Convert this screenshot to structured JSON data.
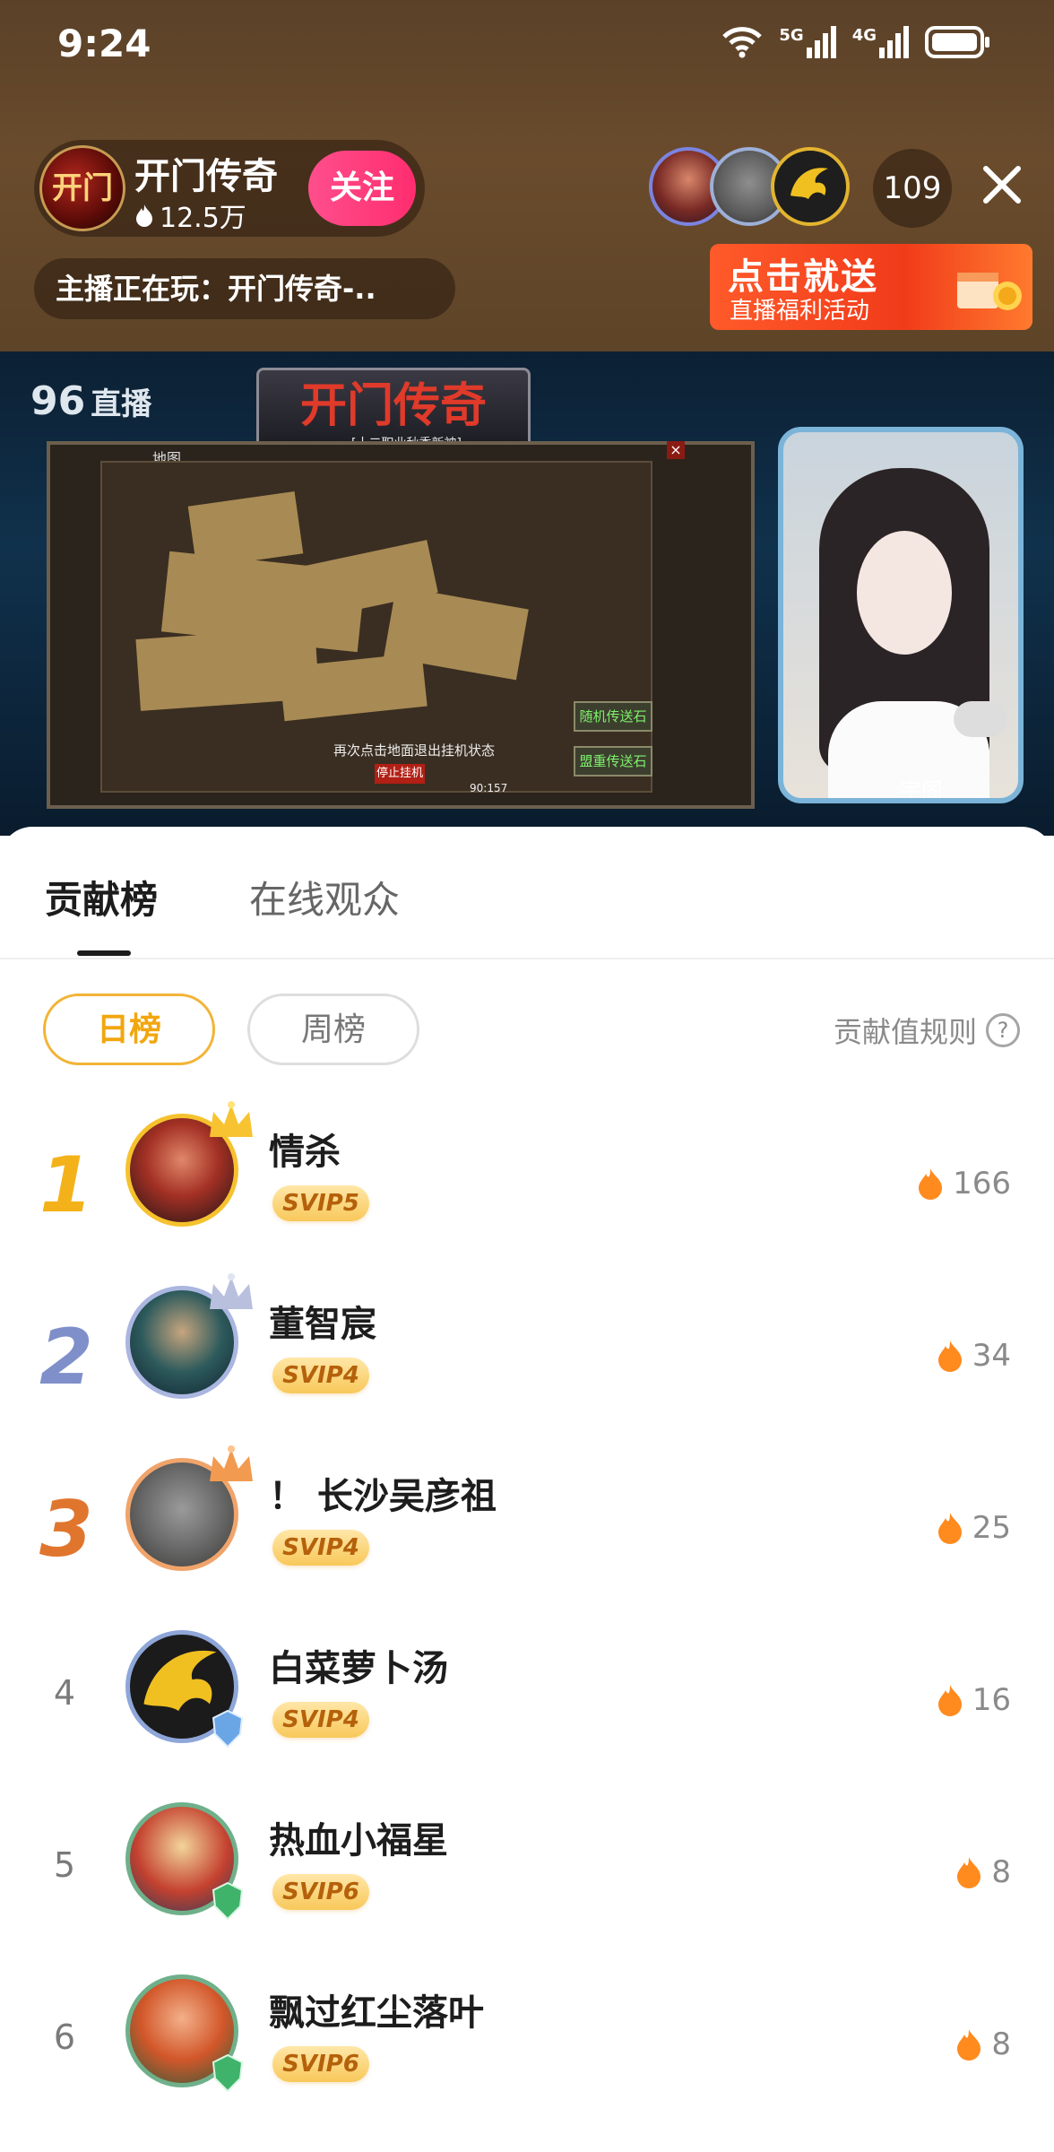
{
  "status_bar": {
    "time": "9:24",
    "network_1": "5G",
    "network_2": "4G"
  },
  "streamer": {
    "name": "开门传奇",
    "fans": "12.5万",
    "avatar_text": "开门",
    "follow_label": "关注",
    "now_playing": "主播正在玩：开门传奇-.."
  },
  "viewers": {
    "count": "109"
  },
  "promo": {
    "title": "点击就送",
    "subtitle": "直播福利活动"
  },
  "video": {
    "platform_logo_num": "96",
    "platform_logo_text": "直播",
    "game_title": "开门传奇",
    "game_subtitle": "[十二职业秋季新神]",
    "map_label": "地图",
    "map_hint": "再次点击地面退出挂机状态",
    "map_stop": "停止挂机",
    "map_btn_1": "随机传送石",
    "map_btn_2": "盟重传送石",
    "map_coords": "90:157",
    "streamer_tag": "宇阁"
  },
  "sheet": {
    "tabs": [
      {
        "label": "贡献榜",
        "active": true
      },
      {
        "label": "在线观众",
        "active": false
      }
    ],
    "chips": [
      {
        "label": "日榜",
        "active": true
      },
      {
        "label": "周榜",
        "active": false
      }
    ],
    "rules_label": "贡献值规则",
    "rules_icon": "?"
  },
  "ranking": [
    {
      "rank": "1",
      "name": "情杀",
      "vip": "SVIP5",
      "score": "166"
    },
    {
      "rank": "2",
      "name": "董智宸",
      "vip": "SVIP4",
      "score": "34"
    },
    {
      "rank": "3",
      "name": "！ 长沙吴彦祖",
      "vip": "SVIP4",
      "score": "25"
    },
    {
      "rank": "4",
      "name": "白菜萝卜汤",
      "vip": "SVIP4",
      "score": "16"
    },
    {
      "rank": "5",
      "name": "热血小福星",
      "vip": "SVIP6",
      "score": "8"
    },
    {
      "rank": "6",
      "name": "飘过红尘落叶",
      "vip": "SVIP6",
      "score": "8"
    }
  ],
  "colors": {
    "accent_gold": "#f2a60e",
    "follow_pink": "#ff2d6f",
    "flame": "#ff7a1a",
    "header_brown": "#5e4428"
  }
}
